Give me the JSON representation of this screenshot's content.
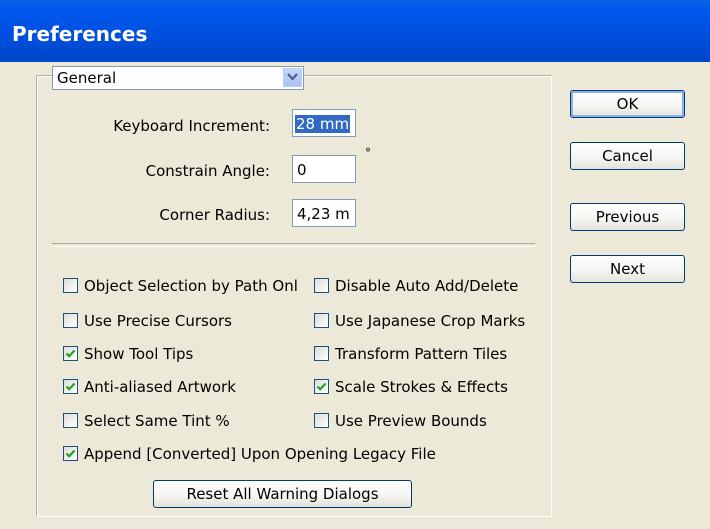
{
  "window": {
    "title": "Preferences"
  },
  "category": {
    "selected": "General"
  },
  "fields": {
    "keyboard_increment": {
      "label": "Keyboard Increment:",
      "value": "28 mm"
    },
    "constrain_angle": {
      "label": "Constrain Angle:",
      "value": "0",
      "unit": "°"
    },
    "corner_radius": {
      "label": "Corner Radius:",
      "value": "4,23 m"
    }
  },
  "checkboxes": {
    "object_selection": {
      "label": "Object Selection by Path Onl",
      "checked": false
    },
    "disable_auto_add": {
      "label": "Disable Auto Add/Delete",
      "checked": false
    },
    "precise_cursors": {
      "label": "Use Precise Cursors",
      "checked": false
    },
    "japanese_crop": {
      "label": "Use Japanese Crop Marks",
      "checked": false
    },
    "tool_tips": {
      "label": "Show Tool Tips",
      "checked": true
    },
    "transform_pattern": {
      "label": "Transform Pattern Tiles",
      "checked": false
    },
    "anti_aliased": {
      "label": "Anti-aliased Artwork",
      "checked": true
    },
    "scale_strokes": {
      "label": "Scale Strokes & Effects",
      "checked": true
    },
    "same_tint": {
      "label": "Select Same Tint %",
      "checked": false
    },
    "preview_bounds": {
      "label": "Use Preview Bounds",
      "checked": false
    },
    "append_converted": {
      "label": "Append [Converted] Upon Opening Legacy File",
      "checked": true
    }
  },
  "buttons": {
    "ok": "OK",
    "cancel": "Cancel",
    "previous": "Previous",
    "next": "Next",
    "reset_warnings": "Reset All Warning Dialogs"
  },
  "colors": {
    "titlebar": "#0050e0",
    "selection": "#316ac5",
    "dialog_bg": "#ece9d8"
  },
  "icons": {
    "dropdown": "chevron-down-icon",
    "check": "checkmark-icon"
  }
}
